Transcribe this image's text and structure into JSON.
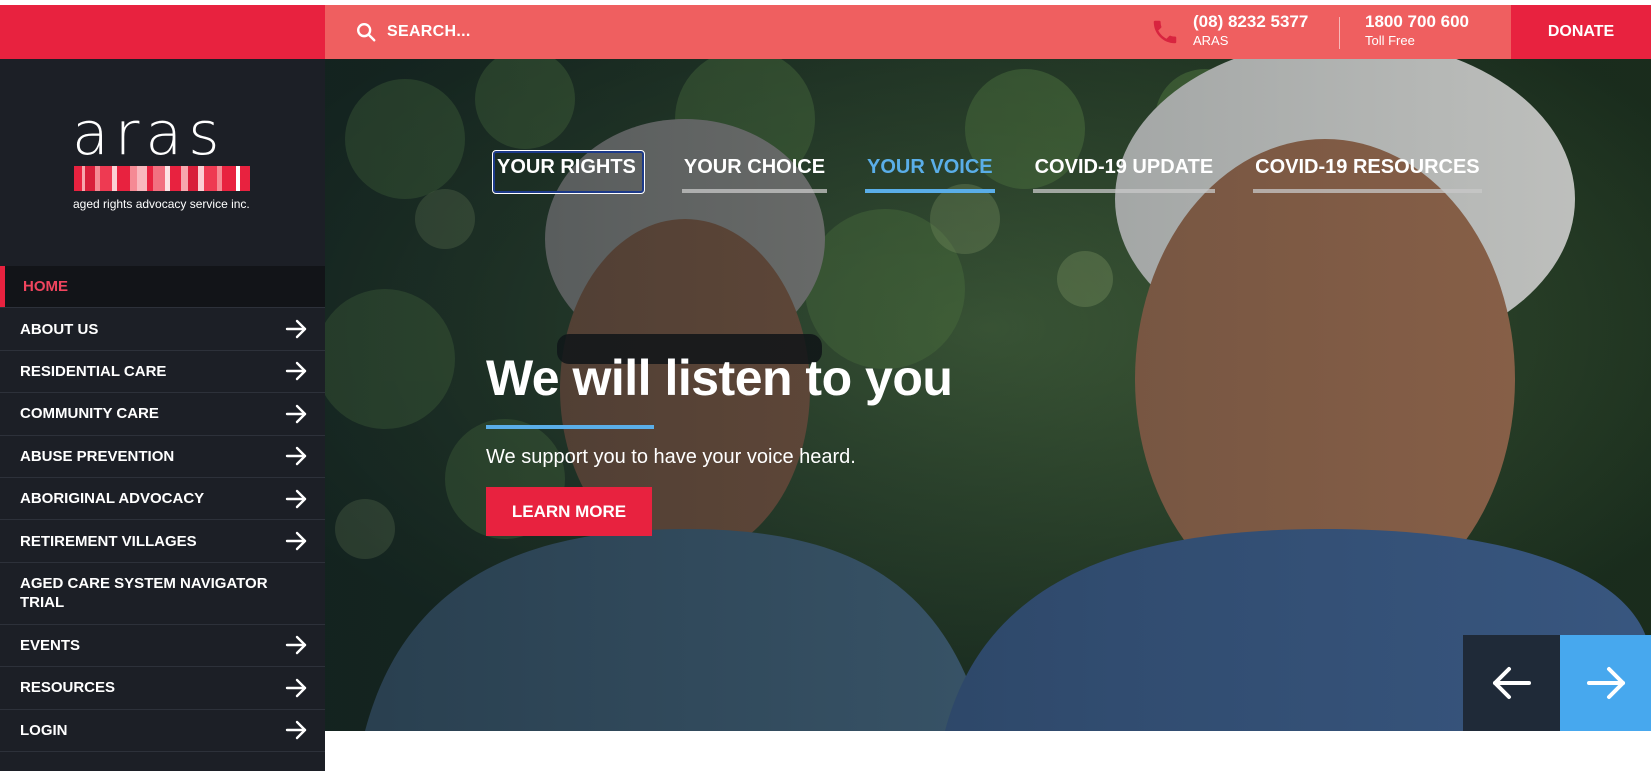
{
  "colors": {
    "brand_red": "#e8223f",
    "topbar_coral": "#ef5f60",
    "sidebar_dark": "#1c1f26",
    "accent_blue": "#5aaee8"
  },
  "logo": {
    "word": "aras",
    "tagline": "aged rights advocacy service inc."
  },
  "search": {
    "placeholder": "SEARCH...",
    "icon": "search-icon"
  },
  "contact": [
    {
      "number": "(08) 8232 5377",
      "label": "ARAS"
    },
    {
      "number": "1800 700 600",
      "label": "Toll Free"
    }
  ],
  "donate_label": "DONATE",
  "nav": [
    {
      "label": "HOME",
      "active": true,
      "arrow": false
    },
    {
      "label": "ABOUT US",
      "arrow": true
    },
    {
      "label": "RESIDENTIAL CARE",
      "arrow": true
    },
    {
      "label": "COMMUNITY CARE",
      "arrow": true
    },
    {
      "label": "ABUSE PREVENTION",
      "arrow": true
    },
    {
      "label": "ABORIGINAL ADVOCACY",
      "arrow": true
    },
    {
      "label": "RETIREMENT VILLAGES",
      "arrow": true
    },
    {
      "label": "AGED CARE SYSTEM NAVIGATOR TRIAL",
      "arrow": false
    },
    {
      "label": "EVENTS",
      "arrow": true
    },
    {
      "label": "RESOURCES",
      "arrow": true
    },
    {
      "label": "LOGIN",
      "arrow": true
    }
  ],
  "hero": {
    "tabs": [
      {
        "label": "YOUR RIGHTS",
        "state": "focused"
      },
      {
        "label": "YOUR CHOICE",
        "state": "normal"
      },
      {
        "label": "YOUR VOICE",
        "state": "active"
      },
      {
        "label": "COVID-19 UPDATE",
        "state": "normal"
      },
      {
        "label": "COVID-19 RESOURCES",
        "state": "normal"
      }
    ],
    "title": "We will listen to you",
    "subtitle": "We support you to have your voice heard.",
    "cta": "LEARN MORE"
  }
}
